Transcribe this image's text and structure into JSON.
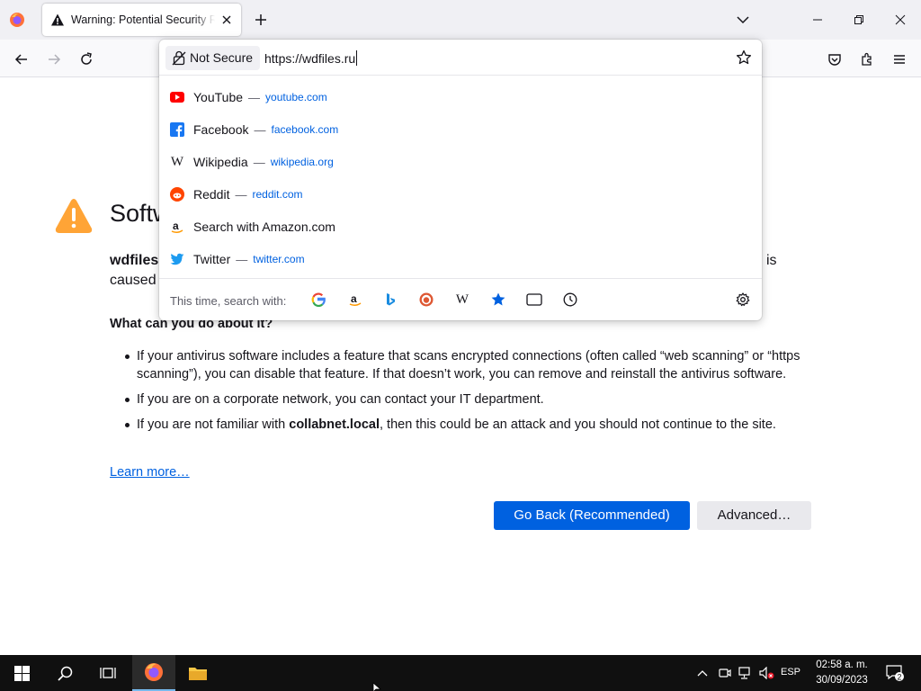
{
  "tab": {
    "title": "Warning: Potential Security Risk Ahead"
  },
  "urlbar": {
    "security_label": "Not Secure",
    "value": "https://wdfiles.ru",
    "results": [
      {
        "title": "YouTube",
        "sep": "—",
        "url": "youtube.com",
        "icon": "youtube-icon"
      },
      {
        "title": "Facebook",
        "sep": "—",
        "url": "facebook.com",
        "icon": "facebook-icon"
      },
      {
        "title": "Wikipedia",
        "sep": "—",
        "url": "wikipedia.org",
        "icon": "wikipedia-icon"
      },
      {
        "title": "Reddit",
        "sep": "—",
        "url": "reddit.com",
        "icon": "reddit-icon"
      },
      {
        "title": "Search with Amazon.com",
        "sep": "",
        "url": "",
        "icon": "amazon-icon"
      },
      {
        "title": "Twitter",
        "sep": "—",
        "url": "twitter.com",
        "icon": "twitter-icon"
      }
    ],
    "oneoff_label": "This time, search with:",
    "engines": [
      "google-icon",
      "amazon-icon",
      "bing-icon",
      "duckduckgo-icon",
      "wikipedia-icon",
      "bookmarks-icon",
      "tabs-icon",
      "history-icon"
    ]
  },
  "page": {
    "title_visible": "Softw",
    "intro_start": "wdfiles",
    "intro_line2": "caused",
    "intro_tail": "is",
    "what_heading": "What can you do about it?",
    "bullet1": "If your antivirus software includes a feature that scans encrypted connections (often called “web scanning” or “https scanning”), you can disable that feature. If that doesn’t work, you can remove and reinstall the antivirus software.",
    "bullet2": "If you are on a corporate network, you can contact your IT department.",
    "bullet3_pre": "If you are not familiar with ",
    "bullet3_bold": "collabnet.local",
    "bullet3_post": ", then this could be an attack and you should not continue to the site.",
    "learn_more": "Learn more…",
    "go_back": "Go Back (Recommended)",
    "advanced": "Advanced…"
  },
  "taskbar": {
    "language": "ESP",
    "time": "02:58 a. m.",
    "date": "30/09/2023",
    "notifications": "2"
  },
  "colors": {
    "accent": "#0061e0",
    "warning": "#ffa436",
    "taskbar": "#101010"
  }
}
